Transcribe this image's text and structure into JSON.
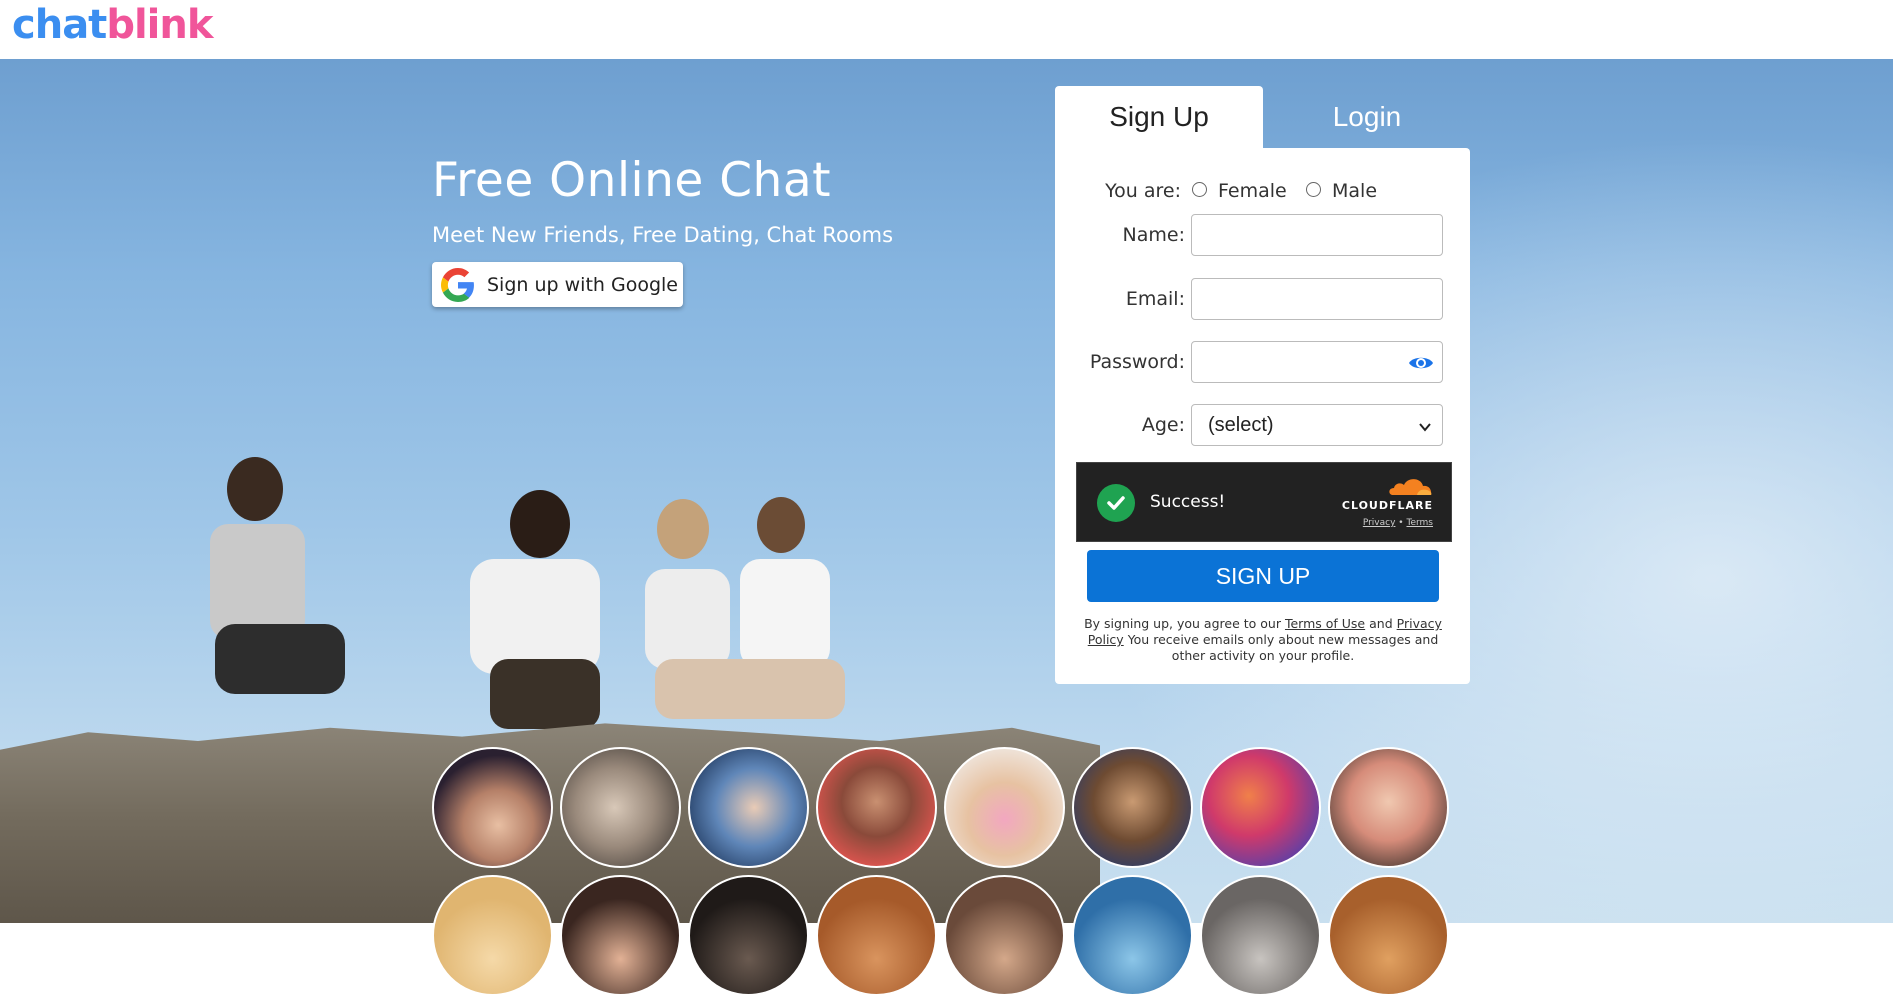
{
  "brand": {
    "part1": "chat",
    "part2": "blink",
    "color1": "#3b8ef0",
    "color2": "#f0559a"
  },
  "hero": {
    "title": "Free Online Chat",
    "subtitle": "Meet New Friends, Free Dating, Chat Rooms",
    "google_button": "Sign up with Google"
  },
  "tabs": {
    "signup": "Sign Up",
    "login": "Login"
  },
  "form": {
    "gender_label": "You are:",
    "gender_female": "Female",
    "gender_male": "Male",
    "name_label": "Name:",
    "name_value": "",
    "email_label": "Email:",
    "email_value": "",
    "password_label": "Password:",
    "password_value": "",
    "age_label": "Age:",
    "age_selected": "(select)"
  },
  "captcha": {
    "status": "Success!",
    "provider": "CLOUDFLARE",
    "privacy": "Privacy",
    "separator": "•",
    "terms": "Terms"
  },
  "signup_button": "SIGN UP",
  "legal": {
    "prefix": "By signing up, you agree to our",
    "terms_link": "Terms of Use",
    "and": "and",
    "privacy_link": "Privacy Policy",
    "suffix": "You receive emails only about new messages and other activity on your profile."
  },
  "colors": {
    "primary": "#0b73d6",
    "success": "#1fa351",
    "eye_icon": "#1a73e8"
  },
  "avatars_count_visible": 16
}
